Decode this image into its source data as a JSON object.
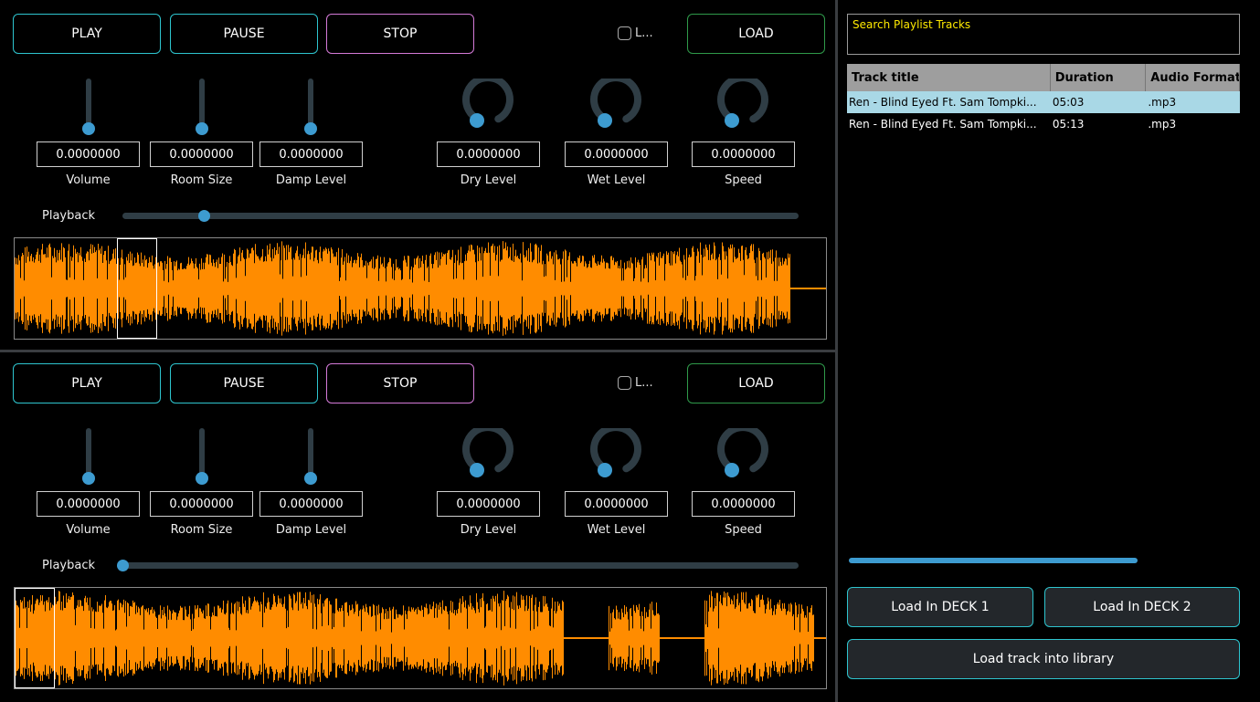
{
  "decks": [
    {
      "buttons": {
        "play": "PLAY",
        "pause": "PAUSE",
        "stop": "STOP",
        "load": "LOAD"
      },
      "loop_label": "L...",
      "controls": {
        "volume": {
          "label": "Volume",
          "value": "0.0000000"
        },
        "room_size": {
          "label": "Room Size",
          "value": "0.0000000"
        },
        "damp_level": {
          "label": "Damp Level",
          "value": "0.0000000"
        },
        "dry_level": {
          "label": "Dry Level",
          "value": "0.0000000"
        },
        "wet_level": {
          "label": "Wet Level",
          "value": "0.0000000"
        },
        "speed": {
          "label": "Speed",
          "value": "0.0000000"
        }
      },
      "playback_label": "Playback",
      "playback_position": 0.12
    },
    {
      "buttons": {
        "play": "PLAY",
        "pause": "PAUSE",
        "stop": "STOP",
        "load": "LOAD"
      },
      "loop_label": "L...",
      "controls": {
        "volume": {
          "label": "Volume",
          "value": "0.0000000"
        },
        "room_size": {
          "label": "Room Size",
          "value": "0.0000000"
        },
        "damp_level": {
          "label": "Damp Level",
          "value": "0.0000000"
        },
        "dry_level": {
          "label": "Dry Level",
          "value": "0.0000000"
        },
        "wet_level": {
          "label": "Wet Level",
          "value": "0.0000000"
        },
        "speed": {
          "label": "Speed",
          "value": "0.0000000"
        }
      },
      "playback_label": "Playback",
      "playback_position": 0.0
    }
  ],
  "playlist": {
    "search_placeholder": "Search Playlist Tracks",
    "columns": [
      "Track title",
      "Duration",
      "Audio Format"
    ],
    "rows": [
      {
        "title": "Ren - Blind Eyed Ft. Sam Tompki...",
        "duration": "05:03",
        "format": ".mp3"
      },
      {
        "title": "Ren - Blind Eyed Ft. Sam Tompki...",
        "duration": "05:13",
        "format": ".mp3"
      }
    ],
    "load_deck1": "Load In DECK 1",
    "load_deck2": "Load In DECK 2",
    "load_library": "Load track into library"
  },
  "colors": {
    "waveform": "#ff8c00",
    "accent_blue": "#3d9bd0",
    "play_border": "#2ec5cf",
    "stop_border": "#d47ad8",
    "load_border": "#2f9a4a",
    "search_text": "#ffea00",
    "selected_row": "#a9d8e6"
  }
}
